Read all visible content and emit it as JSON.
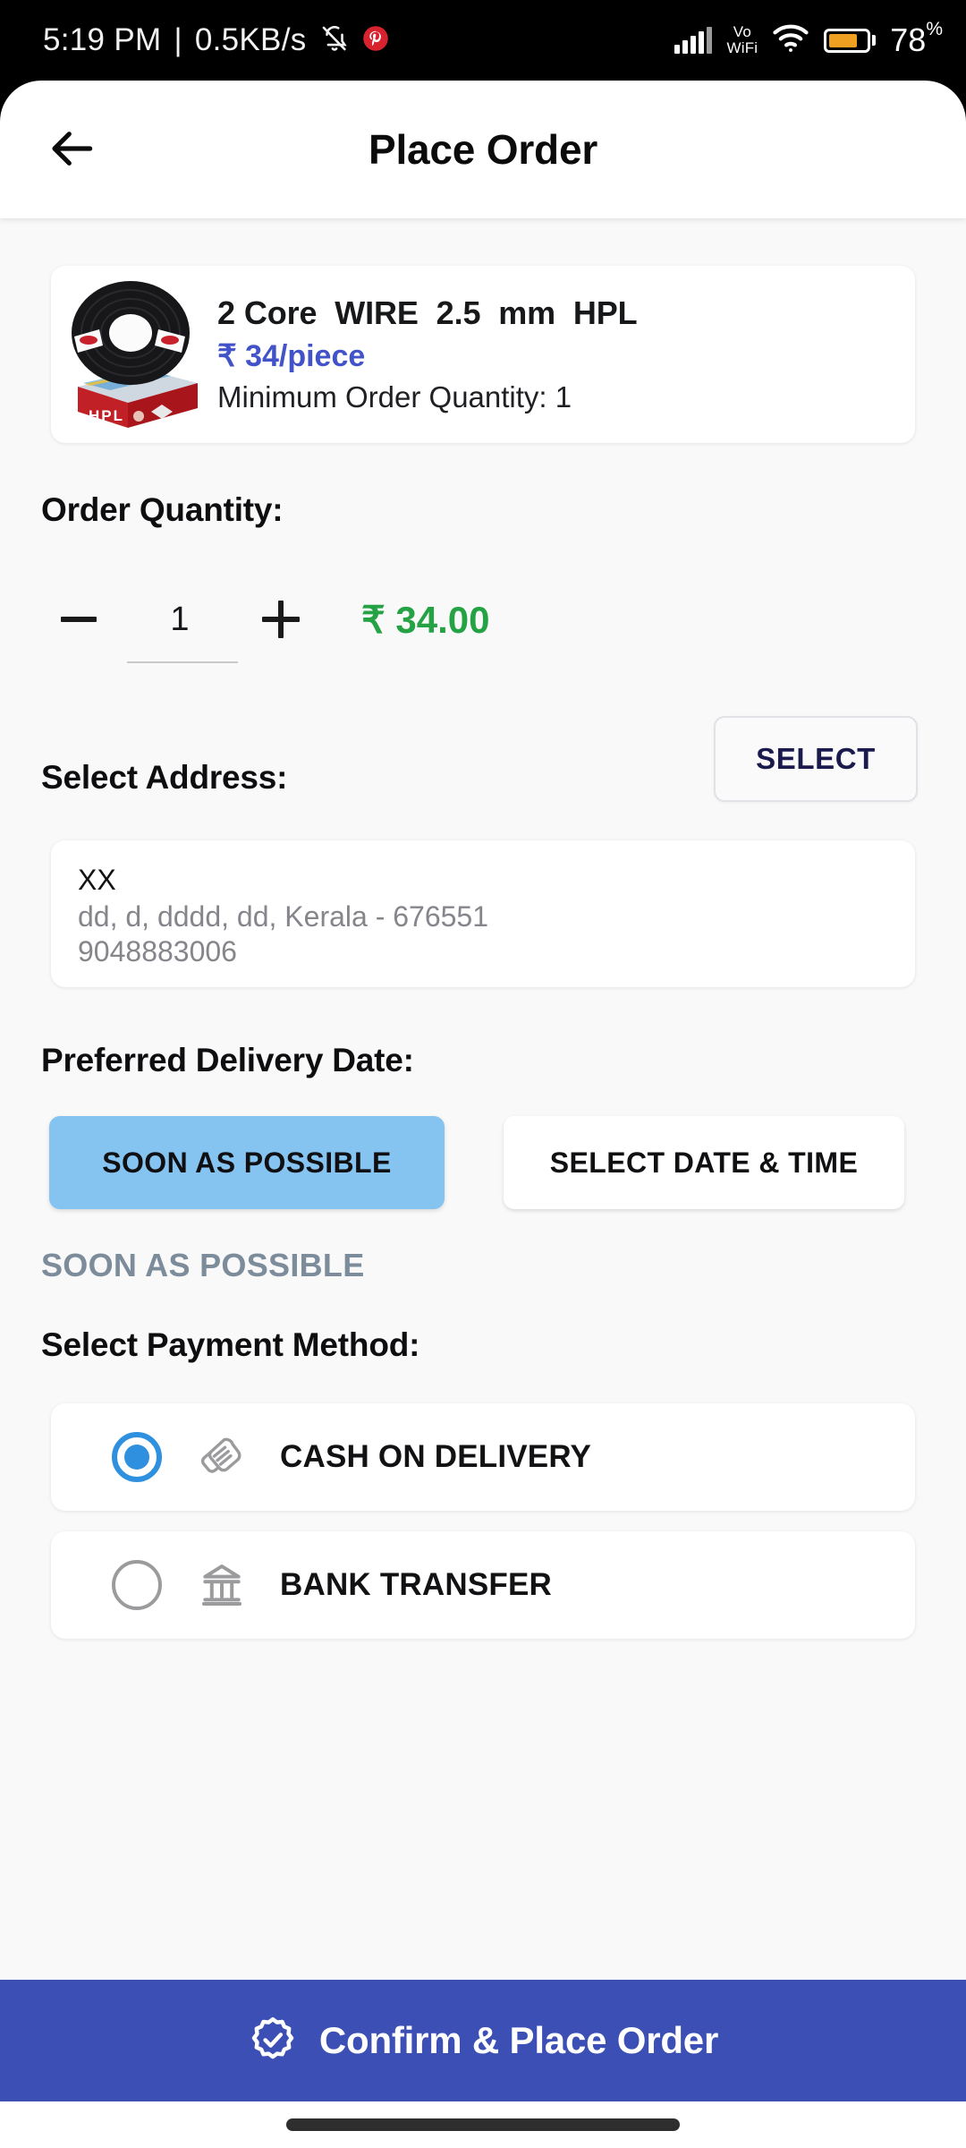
{
  "status_bar": {
    "time": "5:19 PM",
    "separator": "|",
    "network_speed": "0.5KB/s",
    "mute_icon": "bell-muted-icon",
    "pinterest_icon": "pinterest-icon",
    "signal_icon": "cellular-signal-icon",
    "volte_label_line1": "Vo",
    "volte_label_line2": "WiFi",
    "wifi_icon": "wifi-icon",
    "battery_icon": "battery-icon",
    "battery_percent": "78",
    "battery_percent_symbol": "%"
  },
  "header": {
    "back_icon": "back-arrow-icon",
    "title": "Place Order"
  },
  "product": {
    "image_alt": "hpl-wire-coil-product-image",
    "name": "2 Core  WIRE  2.5  mm  HPL",
    "price": "₹ 34/piece",
    "min_order_quantity": "Minimum Order Quantity: 1",
    "brand_label": "HPL"
  },
  "quantity": {
    "title": "Order Quantity:",
    "decrement_icon": "minus-icon",
    "value": "1",
    "increment_icon": "plus-icon",
    "total": "₹ 34.00"
  },
  "address": {
    "title": "Select Address:",
    "select_button": "SELECT",
    "name": "XX",
    "line": "dd, d, dddd, dd, Kerala - 676551",
    "phone": "9048883006"
  },
  "delivery": {
    "title": "Preferred Delivery Date:",
    "option_asap": "SOON AS POSSIBLE",
    "option_pick": "SELECT DATE & TIME",
    "selected_status": "SOON AS POSSIBLE"
  },
  "payment": {
    "title": "Select Payment Method:",
    "methods": [
      {
        "label": "CASH ON DELIVERY",
        "icon": "handshake-icon",
        "selected": true
      },
      {
        "label": "BANK TRANSFER",
        "icon": "bank-icon",
        "selected": false
      }
    ]
  },
  "cta": {
    "icon": "verified-badge-check-icon",
    "label": "Confirm & Place Order"
  },
  "colors": {
    "accent_cta": "#3C4FB4",
    "price_blue": "#4252C9",
    "total_green": "#25A244",
    "radio_blue": "#2E90DE",
    "asap_active": "#85C3F0",
    "status_text": "#7C8C9B",
    "page_background": "#F9F9FA",
    "battery_orange": "#F0A020"
  }
}
